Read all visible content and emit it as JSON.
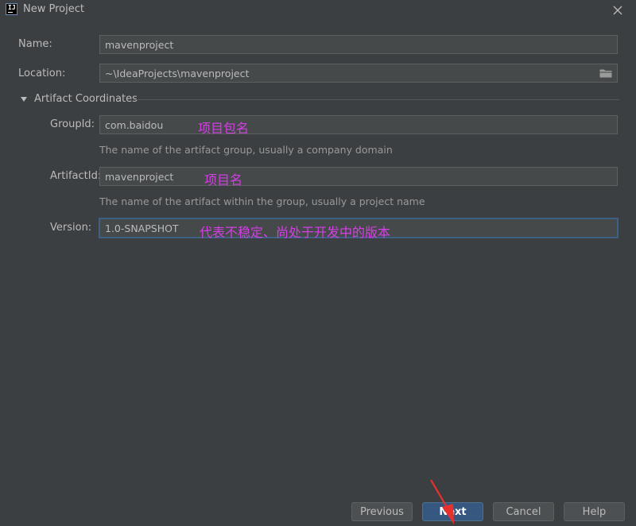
{
  "window": {
    "title": "New Project"
  },
  "form": {
    "name": {
      "label": "Name:",
      "value": "mavenproject"
    },
    "location": {
      "label": "Location:",
      "value": "~\\IdeaProjects\\mavenproject"
    }
  },
  "artifact": {
    "section_title": "Artifact Coordinates",
    "group_id": {
      "label": "GroupId:",
      "value": "com.baidou",
      "hint": "The name of the artifact group, usually a company domain",
      "note": "项目包名"
    },
    "artifact_id": {
      "label": "ArtifactId:",
      "value": "mavenproject",
      "hint": "The name of the artifact within the group, usually a project name",
      "note": "项目名"
    },
    "version": {
      "label": "Version:",
      "value": "1.0-SNAPSHOT",
      "note": "代表不稳定、尚处于开发中的版本"
    }
  },
  "buttons": {
    "previous": "Previous",
    "next": "Next",
    "cancel": "Cancel",
    "help": "Help"
  },
  "colors": {
    "background": "#3c3f41",
    "field": "#45494a",
    "accent": "#365880",
    "annotation": "#d63ee6",
    "arrow": "#e8312b"
  },
  "icons": [
    "intellij-icon",
    "close-icon",
    "folder-icon",
    "triangle-down-icon",
    "red-arrow-icon"
  ]
}
